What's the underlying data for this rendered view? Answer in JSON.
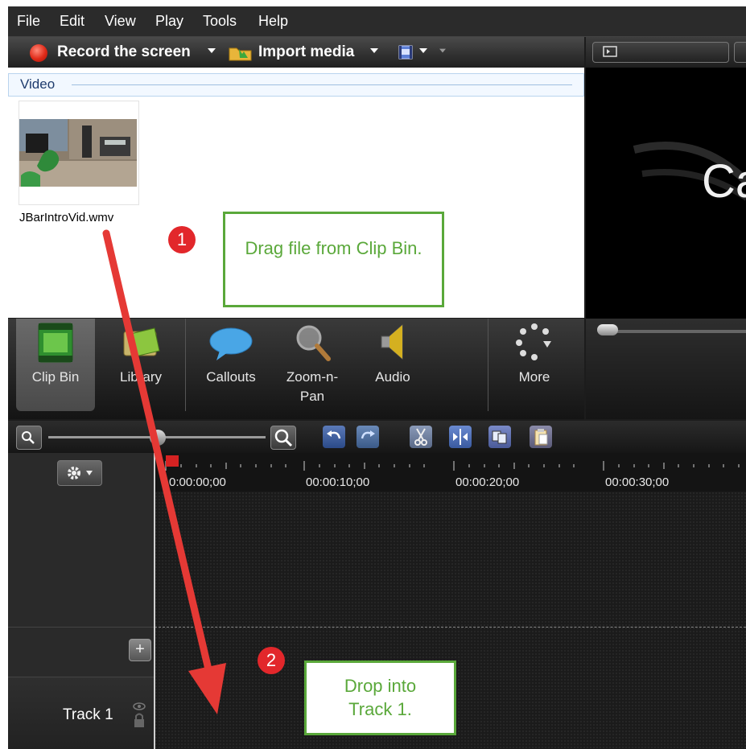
{
  "menu": [
    "File",
    "Edit",
    "View",
    "Play",
    "Tools",
    "Help"
  ],
  "toolbar": {
    "record_label": "Record the screen",
    "import_label": "Import media"
  },
  "clip_bin": {
    "section_label": "Video",
    "clip_name": "JBarIntroVid.wmv"
  },
  "preview": {
    "visible_text": "Ca"
  },
  "tabs": [
    "Clip Bin",
    "Library",
    "Callouts",
    "Zoom-n-Pan",
    "Audio",
    "More"
  ],
  "timeline": {
    "time_labels": [
      "0:00:00;00",
      "00:00:10;00",
      "00:00:20;00",
      "00:00:30;00"
    ],
    "track_name": "Track 1"
  },
  "annotations": {
    "step1_number": "1",
    "step1_text": "Drag file from Clip Bin.",
    "step2_number": "2",
    "step2_text": "Drop into Track 1."
  },
  "colors": {
    "callout_green": "#5aa83a",
    "step_red": "#e2272b",
    "record_red": "#e02a18",
    "video_section_bg": "#f2f8ff"
  }
}
